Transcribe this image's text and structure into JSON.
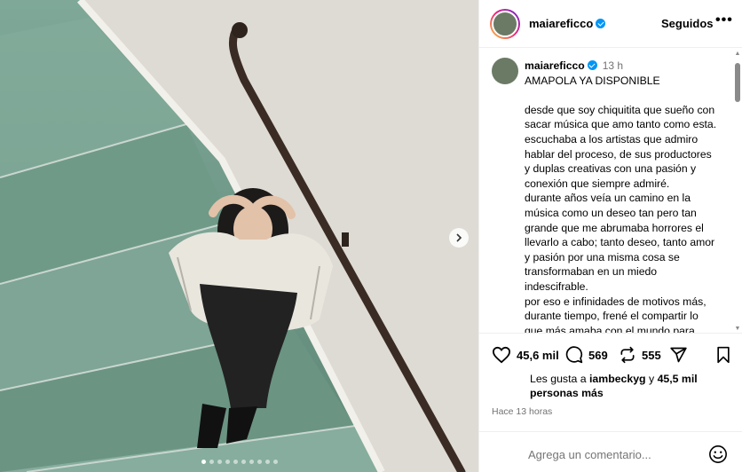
{
  "header": {
    "username": "maiareficco",
    "follow_label": "Seguidos",
    "more_label": "•••"
  },
  "caption": {
    "username": "maiareficco",
    "time": "13 h",
    "lines": [
      "AMAPOLA YA DISPONIBLE",
      "",
      "desde que soy chiquitita que sueño con",
      "sacar música que amo tanto como esta.",
      "escuchaba a los artistas que admiro",
      "hablar del proceso, de sus productores",
      "y duplas creativas con una pasión y",
      "conexión que siempre admiré.",
      "durante años veía un camino en la",
      "música como un deseo tan pero tan",
      "grande que me abrumaba horrores el",
      "llevarlo a cabo; tanto deseo, tanto amor",
      "y pasión por una misma cosa se",
      "transformaban en un miedo",
      "indescifrable.",
      "por eso e infinidades de motivos más,",
      "durante tiempo, frené el compartir lo",
      "que más amaba con el mundo para"
    ]
  },
  "actions": {
    "likes": "45,6 mil",
    "comments": "569",
    "reposts": "555"
  },
  "likes_line": {
    "prefix": "Les gusta a ",
    "user": "iambeckyg",
    "middle": " y ",
    "others": "45,5 mil personas más"
  },
  "time_ago": "Hace 13 horas",
  "comment": {
    "placeholder": "Agrega un comentario..."
  },
  "carousel": {
    "total": 10,
    "active": 0
  },
  "colors": {
    "verified": "#0095f6",
    "secondary_text": "#737373",
    "stairs": "#6f9a88"
  },
  "icons": [
    "heart-icon",
    "comment-icon",
    "repost-icon",
    "share-icon",
    "bookmark-icon",
    "emoji-icon",
    "chevron-right-icon",
    "verified-icon"
  ]
}
